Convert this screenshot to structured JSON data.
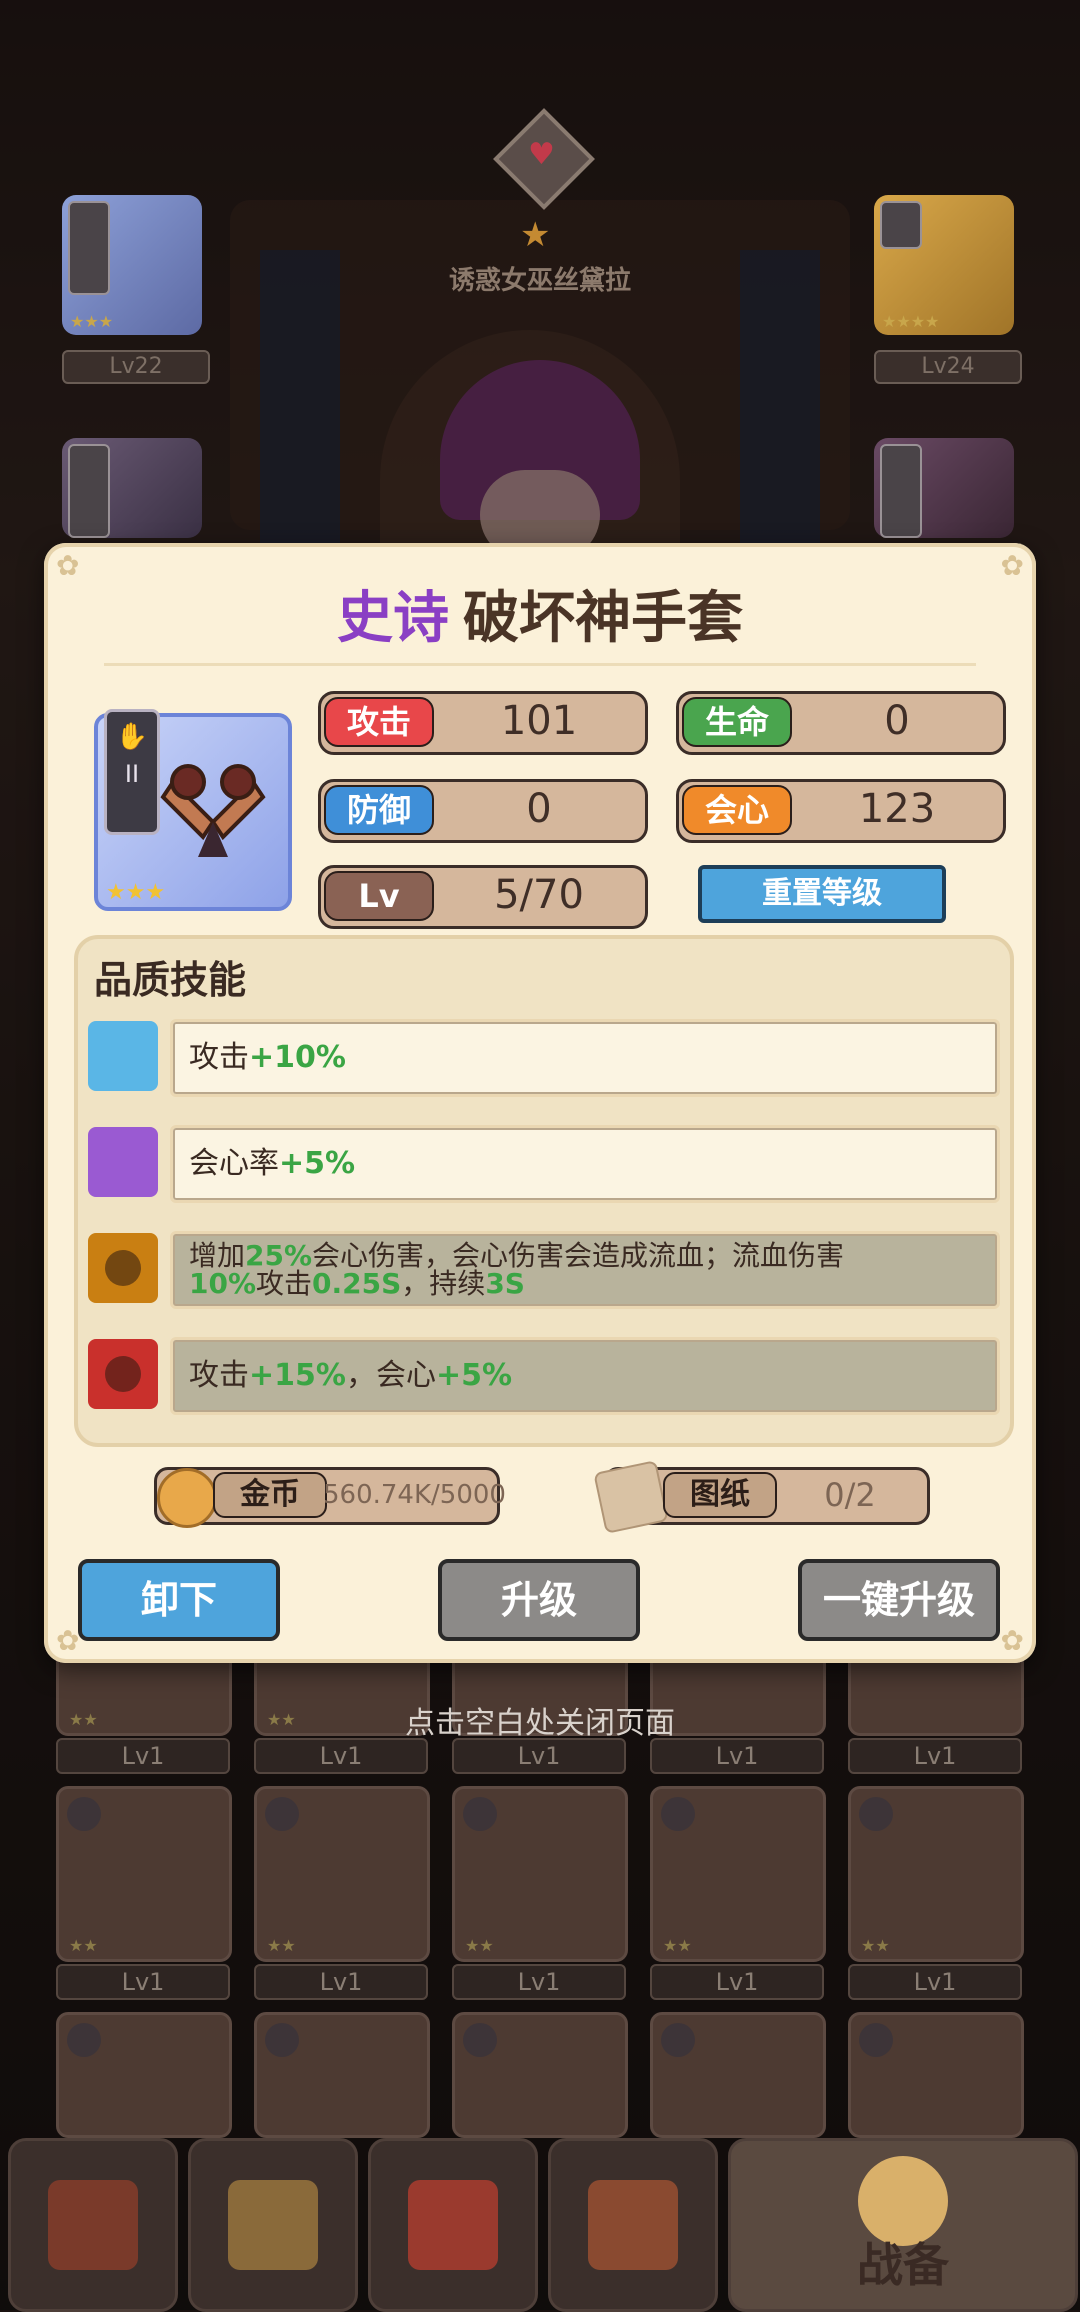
{
  "background": {
    "character_name": "诱惑女巫丝黛拉",
    "hint": "点击空白处关闭页面",
    "equip_slots": [
      {
        "level": "Lv22",
        "tier": "I",
        "stars": "★★★"
      },
      {
        "level": "Lv24",
        "tier": "",
        "stars": "★★★★"
      },
      {
        "level": "",
        "tier": "II",
        "stars": ""
      },
      {
        "level": "",
        "tier": "II",
        "stars": ""
      }
    ],
    "inventory_rows": [
      [
        "Lv1",
        "Lv1",
        "Lv1",
        "Lv1",
        "Lv1"
      ],
      [
        "Lv1",
        "Lv1",
        "Lv1",
        "Lv1",
        "Lv1"
      ]
    ],
    "inventory_stars": "★★",
    "nav": {
      "items": [
        "treasure-chest",
        "trophy",
        "banner",
        "book"
      ],
      "active_label": "战备"
    }
  },
  "modal": {
    "quality": "史诗",
    "item_name": "破坏神手套",
    "item_tier": "II",
    "item_stars": "★★★",
    "stats": [
      {
        "label": "攻击",
        "value": "101",
        "color": "#e8474a"
      },
      {
        "label": "生命",
        "value": "0",
        "color": "#4aa54e"
      },
      {
        "label": "防御",
        "value": "0",
        "color": "#3f8fd8"
      },
      {
        "label": "会心",
        "value": "123",
        "color": "#f08a2a"
      },
      {
        "label": "Lv",
        "value": "5/70",
        "color": "#8a6254"
      }
    ],
    "reset_button": "重置等级",
    "skills_title": "品质技能",
    "skills": [
      {
        "color": "#5ab6e6",
        "prefix": "攻击",
        "bonus": "+10%",
        "locked": false
      },
      {
        "color": "#9a5ad2",
        "prefix": "会心率",
        "bonus": "+5%",
        "locked": false
      },
      {
        "color": "#c97f12",
        "locked": true,
        "parts": [
          "增加",
          "25%",
          "会心伤害，会心伤害会造成流血；流血伤害",
          "10%",
          "攻击",
          "0.25S",
          "，持续",
          "3S"
        ]
      },
      {
        "color": "#c9302c",
        "locked": true,
        "parts": [
          "攻击",
          "+15%",
          "，会心",
          "+5%"
        ]
      }
    ],
    "resources": {
      "gold_label": "金币",
      "gold_value": "560.74K/5000",
      "blueprint_label": "图纸",
      "blueprint_value": "0/2"
    },
    "buttons": {
      "unequip": "卸下",
      "upgrade": "升级",
      "one_key_upgrade": "一键升级"
    }
  }
}
